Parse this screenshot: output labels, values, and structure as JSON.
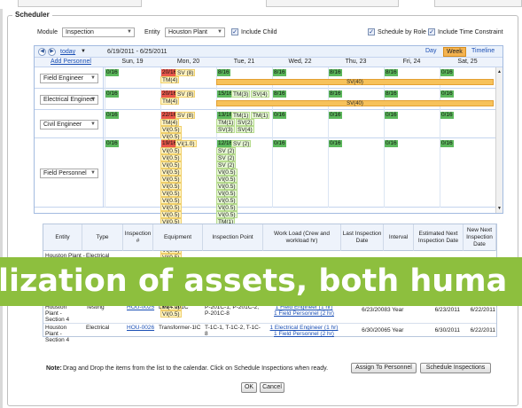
{
  "panel": {
    "title": "Scheduler"
  },
  "filters": {
    "module_label": "Module",
    "module_value": "Inspection",
    "entity_label": "Entity",
    "entity_value": "Houston Plant",
    "include_child": "Include Child",
    "schedule_by_role": "Schedule by Role",
    "include_time_constraint": "Include Time Constraint"
  },
  "calendar": {
    "today": "today",
    "range": "6/19/2011 - 6/25/2011",
    "views": [
      "Day",
      "Week",
      "Timeline"
    ],
    "add_personnel": "Add Personnel",
    "days": [
      "Sun, 19",
      "Mon, 20",
      "Tue, 21",
      "Wed, 22",
      "Thu, 23",
      "Fri, 24",
      "Sat, 25"
    ],
    "rows": [
      {
        "role": "Field Engineer",
        "counts": [
          "0/16",
          "20/16",
          "8/16",
          "8/16",
          "8/16",
          "8/16",
          "0/16"
        ],
        "mon_tags": [
          "SV (8)",
          "TM(4)"
        ],
        "tue_tags": [],
        "bar": "SV(40)"
      },
      {
        "role": "Electrical Engineer",
        "counts": [
          "0/16",
          "20/16",
          "15/16",
          "8/16",
          "8/16",
          "8/16",
          "0/16"
        ],
        "mon_tags": [
          "SV (8)",
          "TM(4)"
        ],
        "tue_tags": [
          "TM(3)",
          "SV(4)"
        ],
        "bar": "SV(40)"
      },
      {
        "role": "Civil Engineer",
        "counts": [
          "0/16",
          "22/16",
          "13/16",
          "0/16",
          "0/16",
          "0/16",
          "0/16"
        ],
        "mon_tags": [
          "SV (8)",
          "TM(4)",
          "VI(0.5)",
          "VI(0.5)",
          "VI(4.0)",
          "VI(4.0)"
        ],
        "tue_tags": [
          "TM(1)",
          "TM(1)",
          "TM(1)",
          "SV(2)",
          "SV(3)",
          "SV(4)"
        ]
      },
      {
        "role": "Field Personnel",
        "counts": [
          "0/16",
          "19/16",
          "12/16",
          "0/16",
          "0/16",
          "0/16",
          "0/16"
        ],
        "mon_tags": [
          "VI(1.0)",
          "VI(0.5)",
          "VI(0.5)",
          "VI(0.5)",
          "VI(0.5)",
          "VI(0.5)",
          "VI(0.5)",
          "VI(0.5)",
          "VI(0.5)",
          "VI(0.5)",
          "VI(0.5)",
          "VI(0.5)",
          "VI(0.5)",
          "VI(0.5)",
          "VI(0.5)",
          "VI(0.5)",
          "VI(0.5)",
          "VI(0.5)",
          "VI(0.5)",
          "VI(0.5)",
          "VI(0.5)",
          "VI(0.5)",
          "VI(4.0)",
          "VI(4.0)",
          "VI(0.5)"
        ],
        "tue_tags": [
          "SV (2)",
          "SV (2)",
          "SV (2)",
          "SV (2)",
          "VI(0.5)",
          "VI(0.5)",
          "VI(0.5)",
          "VI(0.5)",
          "VI(0.5)",
          "VI(0.5)",
          "VI(0.5)",
          "TM(1)"
        ]
      }
    ]
  },
  "table": {
    "headers": [
      "Entity",
      "Type",
      "Inspection #",
      "Equipment",
      "Inspection Point",
      "Work Load (Crew and workload hr)",
      "Last Inspection Date",
      "Interval",
      "Estimated Next Inspection Date",
      "New Next Inspection Date"
    ],
    "rows": [
      {
        "entity": "Houston Plant - Section 4",
        "type": "Testing",
        "number": "HOU-0025",
        "equipment": "Line - 201C",
        "point": "P-201C-1, P-201C-2, P-201C-8",
        "workload": [
          "1 Field Engineer (1 hr)",
          "1 Field Personnel (2 hr)"
        ],
        "last": "6/23/2008",
        "interval": "3 Year",
        "est": "6/23/2011",
        "new": "6/22/2011"
      },
      {
        "entity": "Houston Plant - Section 4",
        "type": "Electrical",
        "number": "HOU-0026",
        "equipment": "Transformer-1IC",
        "point": "T-1C-1, T-1C-2, T-1C-8",
        "workload": [
          "1 Electrical Engineer (1 hr)",
          "1 Field Personnel (2 hr)"
        ],
        "last": "6/30/2006",
        "interval": "5 Year",
        "est": "6/30/2011",
        "new": "6/22/2011"
      }
    ],
    "first_row_partial": {
      "entity": "Houston Plant -",
      "type": "Electrical"
    }
  },
  "note": {
    "label": "Note:",
    "text": "Drag and Drop the items from the list to the calendar. Click on Schedule Inspections when ready."
  },
  "buttons": {
    "assign": "Assign To Personnel",
    "schedule": "Schedule Inspections",
    "ok": "OK",
    "cancel": "Cancel"
  },
  "banner": {
    "text": "lization of assets, both huma"
  },
  "colors": {
    "banner": "#8dbf3e",
    "over": "#e8564a",
    "ok": "#5cb85c",
    "bar": "#f7c25b",
    "accent": "#f4b350"
  }
}
